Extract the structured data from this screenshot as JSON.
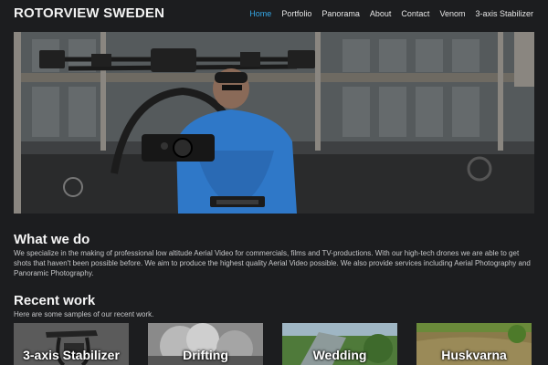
{
  "site": {
    "title": "ROTORVIEW SWEDEN"
  },
  "nav": {
    "items": [
      "Home",
      "Portfolio",
      "Panorama",
      "About",
      "Contact",
      "Venom",
      "3-axis Stabilizer"
    ],
    "active_index": 0,
    "active_color": "#35a7e6"
  },
  "hero": {
    "image_description_icon": "drone-operator-photo"
  },
  "what_we_do": {
    "heading": "What we do",
    "body": "We specialize in the making of professional low altitude Aerial Video for commercials, films and TV-productions. With our high-tech drones we are able to get shots that haven't been possible before. We aim to produce the highest quality Aerial Video possible. We also provide services including Aerial Photography and Panoramic Photography."
  },
  "recent_work": {
    "heading": "Recent work",
    "subtitle": "Here are some samples of our recent work.",
    "items": [
      {
        "label": "3-axis Stabilizer"
      },
      {
        "label": "Drifting"
      },
      {
        "label": "Wedding"
      },
      {
        "label": "Huskvarna"
      }
    ]
  }
}
